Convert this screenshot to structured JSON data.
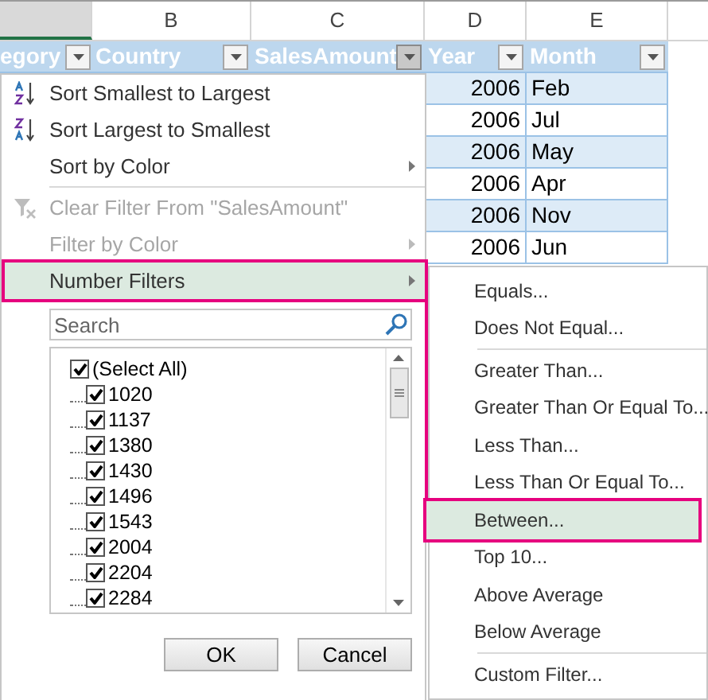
{
  "column_letters": [
    "B",
    "C",
    "D",
    "E"
  ],
  "table_headers": [
    {
      "label": "egory",
      "filter_active": false
    },
    {
      "label": "Country",
      "filter_active": false
    },
    {
      "label": "SalesAmount",
      "filter_active": true
    },
    {
      "label": "Year",
      "filter_active": false
    },
    {
      "label": "Month",
      "filter_active": false
    }
  ],
  "rows": [
    {
      "year": "2006",
      "month": "Feb"
    },
    {
      "year": "2006",
      "month": "Jul"
    },
    {
      "year": "2006",
      "month": "May"
    },
    {
      "year": "2006",
      "month": "Apr"
    },
    {
      "year": "2006",
      "month": "Nov"
    },
    {
      "year": "2006",
      "month": "Jun"
    }
  ],
  "filter_menu": {
    "items": [
      {
        "kind": "ascending",
        "label": "Sort Smallest to Largest",
        "disabled": false,
        "submenu": false,
        "selected": false
      },
      {
        "kind": "descending",
        "label": "Sort Largest to Smallest",
        "disabled": false,
        "submenu": false,
        "selected": false
      },
      {
        "kind": "item",
        "label": "Sort by Color",
        "disabled": false,
        "submenu": true,
        "selected": false
      },
      {
        "kind": "separator"
      },
      {
        "kind": "clear",
        "label": "Clear Filter From \"SalesAmount\"",
        "disabled": true,
        "submenu": false,
        "selected": false
      },
      {
        "kind": "item",
        "label": "Filter by Color",
        "disabled": true,
        "submenu": true,
        "selected": false
      },
      {
        "kind": "item",
        "label": "Number Filters",
        "disabled": false,
        "submenu": true,
        "selected": true
      }
    ],
    "search": {
      "placeholder": "Search"
    },
    "values": [
      {
        "label": "(Select All)",
        "checked": true
      },
      {
        "label": "1020",
        "checked": true
      },
      {
        "label": "1137",
        "checked": true
      },
      {
        "label": "1380",
        "checked": true
      },
      {
        "label": "1430",
        "checked": true
      },
      {
        "label": "1496",
        "checked": true
      },
      {
        "label": "1543",
        "checked": true
      },
      {
        "label": "2004",
        "checked": true
      },
      {
        "label": "2204",
        "checked": true
      },
      {
        "label": "2284",
        "checked": true
      }
    ],
    "buttons": [
      "OK",
      "Cancel"
    ]
  },
  "number_filters_menu": [
    {
      "kind": "item",
      "label": "Equals...",
      "selected": false
    },
    {
      "kind": "item",
      "label": "Does Not Equal...",
      "selected": false
    },
    {
      "kind": "separator"
    },
    {
      "kind": "item",
      "label": "Greater Than...",
      "selected": false
    },
    {
      "kind": "item",
      "label": "Greater Than Or Equal To...",
      "selected": false
    },
    {
      "kind": "item",
      "label": "Less Than...",
      "selected": false
    },
    {
      "kind": "item",
      "label": "Less Than Or Equal To...",
      "selected": false
    },
    {
      "kind": "item",
      "label": "Between...",
      "selected": true
    },
    {
      "kind": "item",
      "label": "Top 10...",
      "selected": false
    },
    {
      "kind": "item",
      "label": "Above Average",
      "selected": false
    },
    {
      "kind": "item",
      "label": "Below Average",
      "selected": false
    },
    {
      "kind": "separator"
    },
    {
      "kind": "item",
      "label": "Custom Filter...",
      "selected": false
    }
  ]
}
